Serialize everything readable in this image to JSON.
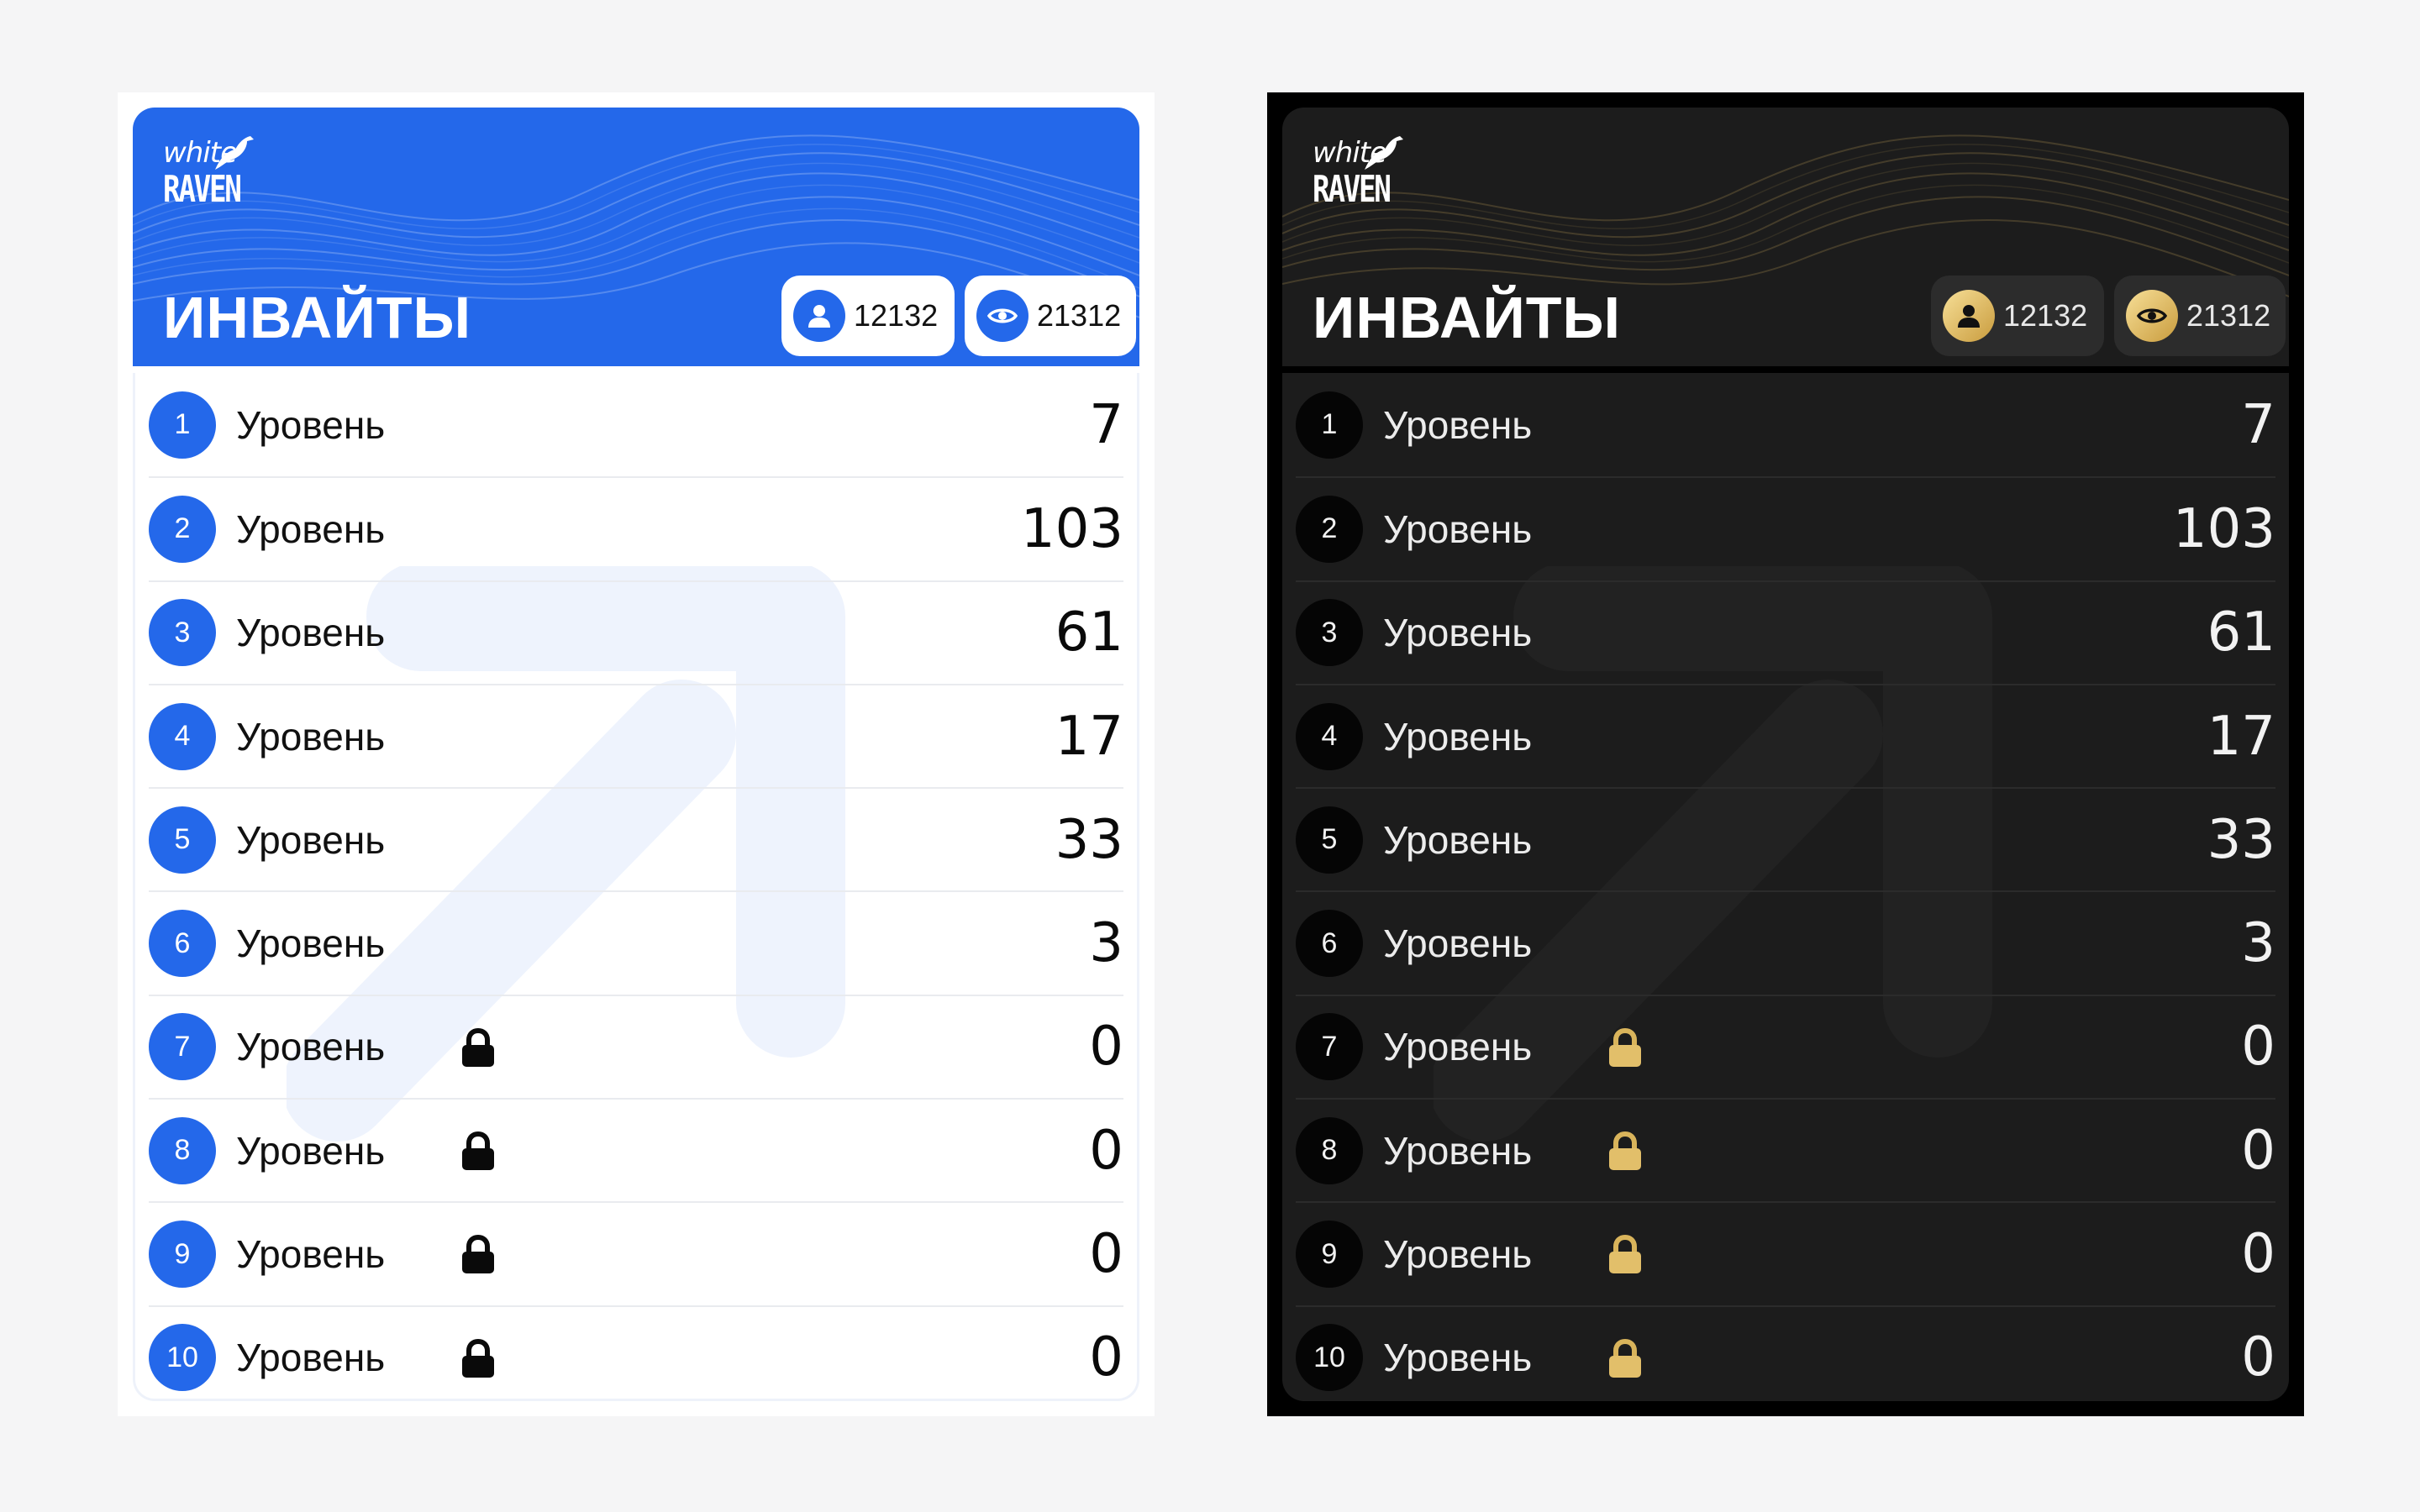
{
  "brand": {
    "line1": "white",
    "line2": "RAVEN"
  },
  "colors": {
    "accent": "#2468ea",
    "gold": "#d8b25a",
    "dark_bg": "#1c1c1c"
  },
  "panels": [
    {
      "theme": "light",
      "title": "ИНВАЙТЫ",
      "stats": {
        "users": {
          "icon": "user-icon",
          "value": "12132"
        },
        "views": {
          "icon": "eye-icon",
          "value": "21312"
        }
      },
      "levels": [
        {
          "num": "1",
          "label": "Уровень",
          "value": "7",
          "locked": false
        },
        {
          "num": "2",
          "label": "Уровень",
          "value": "103",
          "locked": false
        },
        {
          "num": "3",
          "label": "Уровень",
          "value": "61",
          "locked": false
        },
        {
          "num": "4",
          "label": "Уровень",
          "value": "17",
          "locked": false
        },
        {
          "num": "5",
          "label": "Уровень",
          "value": "33",
          "locked": false
        },
        {
          "num": "6",
          "label": "Уровень",
          "value": "3",
          "locked": false
        },
        {
          "num": "7",
          "label": "Уровень",
          "value": "0",
          "locked": true
        },
        {
          "num": "8",
          "label": "Уровень",
          "value": "0",
          "locked": true
        },
        {
          "num": "9",
          "label": "Уровень",
          "value": "0",
          "locked": true
        },
        {
          "num": "10",
          "label": "Уровень",
          "value": "0",
          "locked": true
        }
      ]
    },
    {
      "theme": "dark",
      "title": "ИНВАЙТЫ",
      "stats": {
        "users": {
          "icon": "user-icon",
          "value": "12132"
        },
        "views": {
          "icon": "eye-icon",
          "value": "21312"
        }
      },
      "levels": [
        {
          "num": "1",
          "label": "Уровень",
          "value": "7",
          "locked": false
        },
        {
          "num": "2",
          "label": "Уровень",
          "value": "103",
          "locked": false
        },
        {
          "num": "3",
          "label": "Уровень",
          "value": "61",
          "locked": false
        },
        {
          "num": "4",
          "label": "Уровень",
          "value": "17",
          "locked": false
        },
        {
          "num": "5",
          "label": "Уровень",
          "value": "33",
          "locked": false
        },
        {
          "num": "6",
          "label": "Уровень",
          "value": "3",
          "locked": false
        },
        {
          "num": "7",
          "label": "Уровень",
          "value": "0",
          "locked": true
        },
        {
          "num": "8",
          "label": "Уровень",
          "value": "0",
          "locked": true
        },
        {
          "num": "9",
          "label": "Уровень",
          "value": "0",
          "locked": true
        },
        {
          "num": "10",
          "label": "Уровень",
          "value": "0",
          "locked": true
        }
      ]
    }
  ]
}
